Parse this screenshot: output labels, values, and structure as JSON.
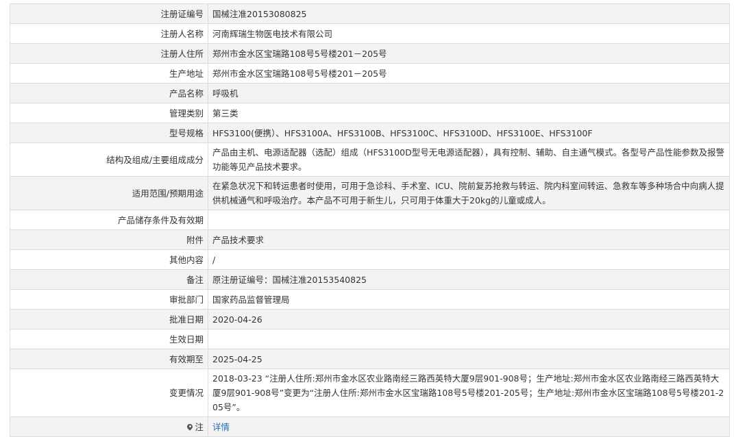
{
  "rows": [
    {
      "label": "注册证编号",
      "value": "国械注准20153080825"
    },
    {
      "label": "注册人名称",
      "value": "河南辉瑞生物医电技术有限公司"
    },
    {
      "label": "注册人住所",
      "value": "郑州市金水区宝瑞路108号5号楼201－205号"
    },
    {
      "label": "生产地址",
      "value": "郑州市金水区宝瑞路108号5号楼201－205号"
    },
    {
      "label": "产品名称",
      "value": "呼吸机"
    },
    {
      "label": "管理类别",
      "value": "第三类"
    },
    {
      "label": "型号规格",
      "value": "HFS3100(便携）、HFS3100A、HFS3100B、HFS3100C、HFS3100D、HFS3100E、HFS3100F"
    },
    {
      "label": "结构及组成/主要组成成分",
      "value": "产品由主机、电源适配器（选配）组成（HFS3100D型号无电源适配器），具有控制、辅助、自主通气模式。各型号产品性能参数及报警功能等见产品技术要求。"
    },
    {
      "label": "适用范围/预期用途",
      "value": "在紧急状况下和转运患者时使用，可用于急诊科、手术室、ICU、院前复苏抢救与转运、院内科室间转运、急救车等多种场合中向病人提供机械通气和呼吸治疗。本产品不可用于新生儿，只可用于体重大于20kg的儿童或成人。"
    },
    {
      "label": "产品储存条件及有效期",
      "value": ""
    },
    {
      "label": "附件",
      "value": "产品技术要求"
    },
    {
      "label": "其他内容",
      "value": "/"
    },
    {
      "label": "备注",
      "value": "原注册证编号：国械注准20153540825"
    },
    {
      "label": "审批部门",
      "value": "国家药品监督管理局"
    },
    {
      "label": "批准日期",
      "value": "2020-04-26"
    },
    {
      "label": "生效日期",
      "value": ""
    },
    {
      "label": "有效期至",
      "value": "2025-04-25"
    },
    {
      "label": "变更情况",
      "value": "2018-03-23 “注册人住所:郑州市金水区农业路南经三路西英特大厦9层901-908号；生产地址:郑州市金水区农业路南经三路西英特大厦9层901-908号”变更为“注册人住所:郑州市金水区宝瑞路108号5号楼201-205号；生产地址:郑州市金水区宝瑞路108号5号楼201-205号”。"
    }
  ],
  "note": {
    "label": "注",
    "link_text": "详情",
    "icon": "pin-icon"
  }
}
